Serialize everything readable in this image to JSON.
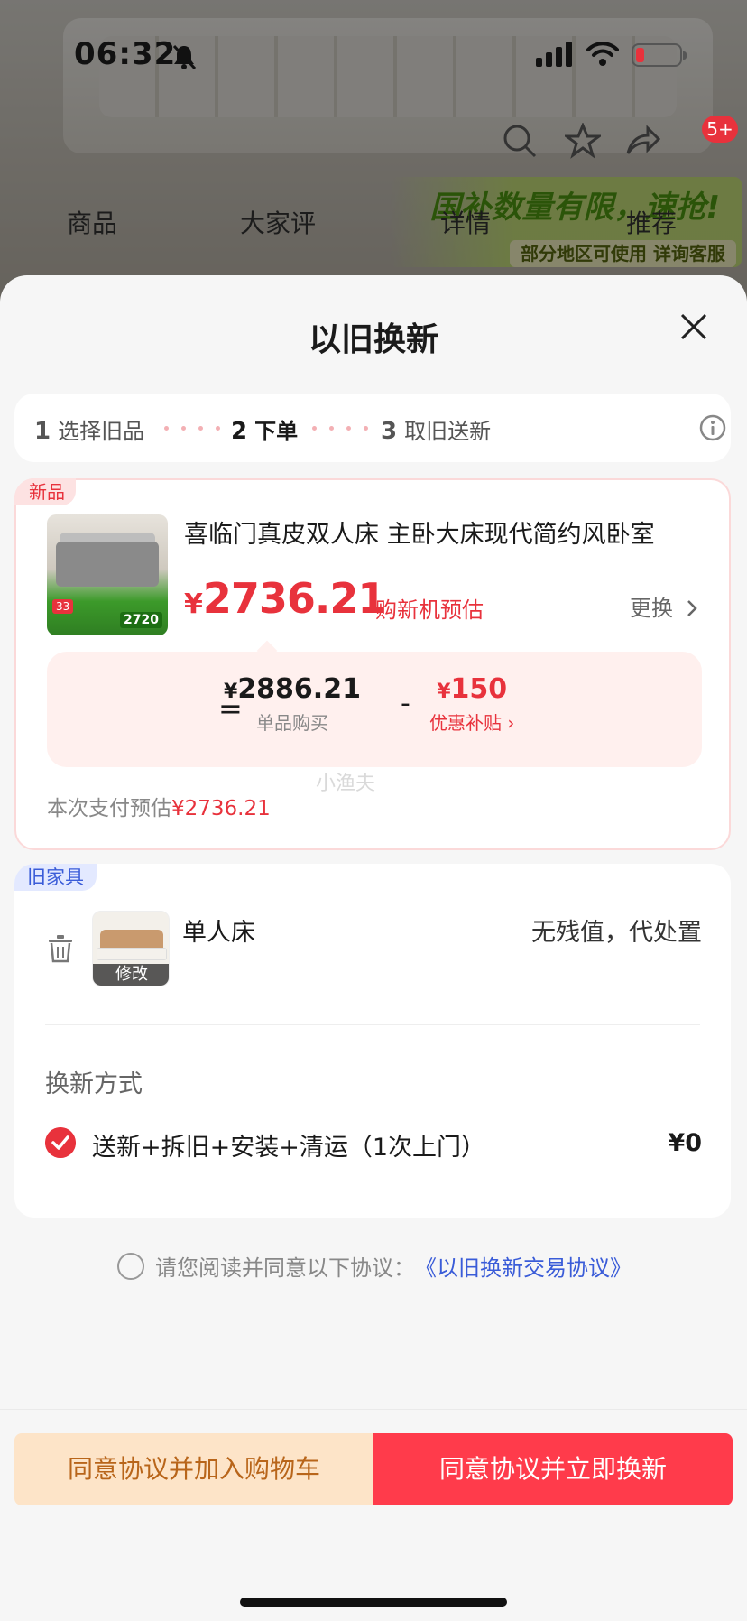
{
  "status_bar": {
    "time": "06:32"
  },
  "background_page": {
    "tabs": [
      "商品",
      "大家评",
      "详情",
      "推荐"
    ],
    "promo_text": "国补数量有限，速抢!",
    "promo_sub": "部分地区可使用 详询客服",
    "cart_badge": "5+"
  },
  "sheet": {
    "title": "以旧换新",
    "steps": [
      {
        "num": "1",
        "label": "选择旧品"
      },
      {
        "num": "2",
        "label": "下单"
      },
      {
        "num": "3",
        "label": "取旧送新"
      }
    ],
    "new_item": {
      "tag": "新品",
      "title": "喜临门真皮双人床 主卧大床现代简约风卧室",
      "price_currency": "¥",
      "price_value": "2736.21",
      "price_note": "购新机预估",
      "change_label": "更换",
      "thumb_price": "2720",
      "thumb_badge": "33",
      "breakdown": {
        "equals": "=",
        "single_currency": "¥",
        "single_value": "2886.21",
        "single_label": "单品购买",
        "minus": "-",
        "subsidy_currency": "¥",
        "subsidy_value": "150",
        "subsidy_label": "优惠补贴 ›"
      },
      "pay_estimate_label": "本次支付预估",
      "pay_estimate_value": "¥2736.21",
      "watermark": "小渔夫"
    },
    "old_item": {
      "tag": "旧家具",
      "name": "单人床",
      "value_text": "无残值，代处置",
      "modify_label": "修改",
      "method_title": "换新方式",
      "method_option": "送新+拆旧+安装+清运（1次上门）",
      "method_price": "¥0"
    },
    "agreement": {
      "text": "请您阅读并同意以下协议：",
      "link": "《以旧换新交易协议》"
    },
    "footer": {
      "cart_button": "同意协议并加入购物车",
      "exchange_button": "同意协议并立即换新"
    }
  },
  "colors": {
    "accent_red": "#e8323c",
    "button_red": "#ff3b4b",
    "link_blue": "#3a5cd8",
    "cart_button_bg": "#fde4c8"
  }
}
